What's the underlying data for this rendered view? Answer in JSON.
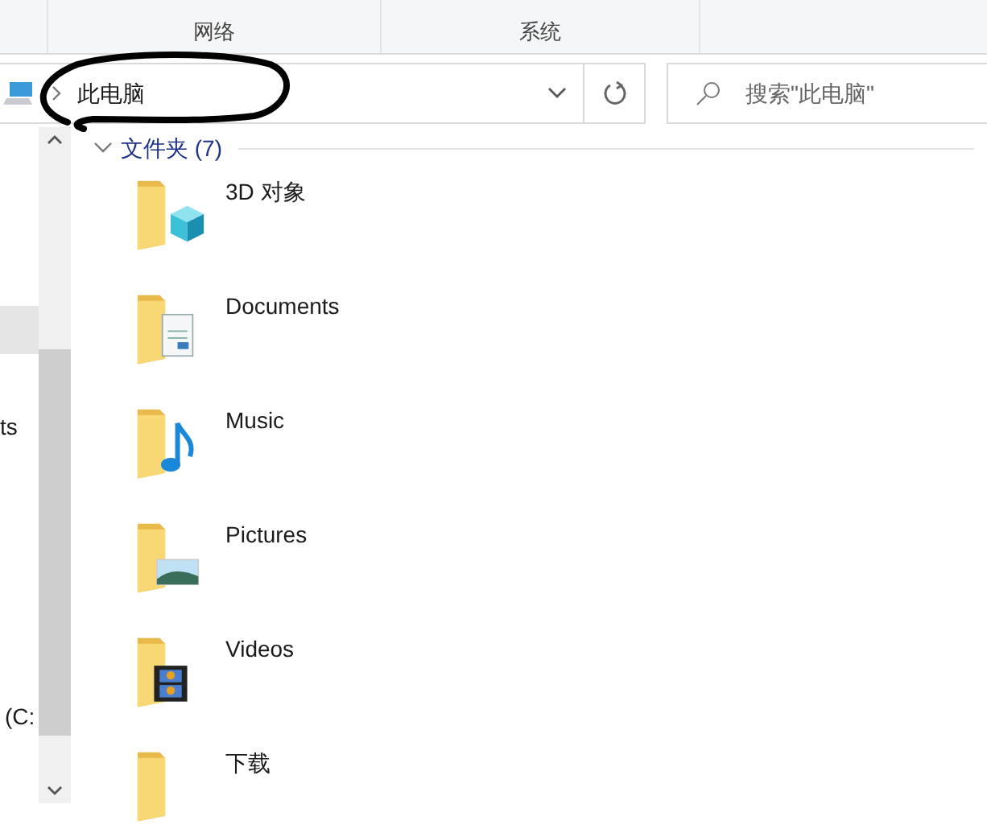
{
  "ribbon_tabs": [
    {
      "label": "网络"
    },
    {
      "label": "系统"
    }
  ],
  "address_bar": {
    "path": "此电脑"
  },
  "search": {
    "placeholder": "搜索\"此电脑\""
  },
  "nav_pane": {
    "items": [
      {
        "selected": true
      },
      {
        "label": "ts",
        "selected": false
      },
      {
        "label": "(C:",
        "selected": false
      }
    ]
  },
  "section": {
    "title": "文件夹 (7)",
    "expanded": true
  },
  "folders": [
    {
      "name": "3D 对象",
      "kind": "objects3d"
    },
    {
      "name": "Documents",
      "kind": "documents"
    },
    {
      "name": "Music",
      "kind": "music"
    },
    {
      "name": "Pictures",
      "kind": "pictures"
    },
    {
      "name": "Videos",
      "kind": "videos"
    },
    {
      "name": "下载",
      "kind": "downloads"
    }
  ]
}
